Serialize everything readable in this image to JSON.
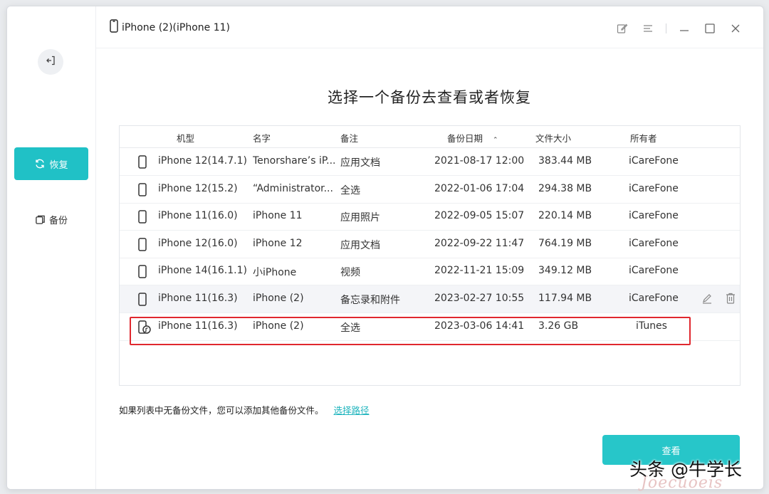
{
  "window": {
    "device_title": "iPhone (2)(iPhone 11)",
    "icons": [
      "edit-note-icon",
      "menu-icon",
      "minimize-icon",
      "maximize-icon",
      "close-icon"
    ]
  },
  "sidebar": {
    "back_icon": "exit-icon",
    "items": [
      {
        "label": "恢复",
        "icon": "refresh-icon",
        "active": true
      },
      {
        "label": "备份",
        "icon": "copy-icon",
        "active": false
      }
    ]
  },
  "main": {
    "heading": "选择一个备份去查看或者恢复",
    "columns": {
      "model": "机型",
      "name": "名字",
      "note": "备注",
      "date": "备份日期",
      "size": "文件大小",
      "owner": "所有者"
    },
    "sort_indicator": "⌃",
    "rows": [
      {
        "model": "iPhone 12(14.7.1)",
        "name": "Tenorshare’s iP...",
        "note": "应用文档",
        "date": "2021-08-17 12:00",
        "size": "383.44 MB",
        "owner": "iCareFone"
      },
      {
        "model": "iPhone 12(15.2)",
        "name": "“Administrator...",
        "note": "全选",
        "date": "2022-01-06 17:04",
        "size": "294.38 MB",
        "owner": "iCareFone"
      },
      {
        "model": "iPhone 11(16.0)",
        "name": "iPhone 11",
        "note": "应用照片",
        "date": "2022-09-05 15:07",
        "size": "220.14 MB",
        "owner": "iCareFone"
      },
      {
        "model": "iPhone 12(16.0)",
        "name": "iPhone 12",
        "note": "应用文档",
        "date": "2022-09-22 11:47",
        "size": "764.19 MB",
        "owner": "iCareFone"
      },
      {
        "model": "iPhone 14(16.1.1)",
        "name": "小iPhone",
        "note": "视频",
        "date": "2022-11-21 15:09",
        "size": "349.12 MB",
        "owner": "iCareFone"
      },
      {
        "model": "iPhone 11(16.3)",
        "name": "iPhone (2)",
        "note": "备忘录和附件",
        "date": "2023-02-27 10:55",
        "size": "117.94 MB",
        "owner": "iCareFone"
      },
      {
        "model": "iPhone 11(16.3)",
        "name": "iPhone (2)",
        "note": "全选",
        "date": "2023-03-06 14:41",
        "size": "3.26 GB",
        "owner": "iTunes"
      }
    ],
    "hint_text": "如果列表中无备份文件，您可以添加其他备份文件。",
    "hint_link": "选择路径",
    "view_button": "查看"
  },
  "colors": {
    "accent": "#20c1c6",
    "highlight_border": "#e0282e",
    "link": "#20b5be"
  },
  "watermark": {
    "text": "头条 @牛学长",
    "subtext": "Joecuoeis"
  }
}
